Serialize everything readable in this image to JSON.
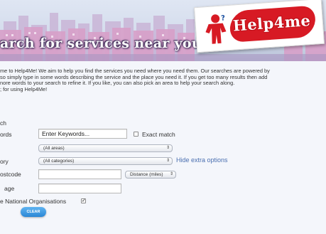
{
  "banner": {
    "title": "arch for services near you...",
    "logo_text": "Help4me"
  },
  "intro": {
    "lines": [
      "me to Help4Me! We aim to help you find the services you need where you need them. Our searches are powered by",
      "so simply type in some words describing the service and the place you need it. If you get too many results then add",
      "nore words to your search to refine it. If you like, you can also pick an area to help your search along.",
      "; for using Help4Me!"
    ]
  },
  "form": {
    "section_label": "ch",
    "keywords_label": "ords",
    "keywords_value": "Enter Keywords...",
    "exact_match_label": "Exact match",
    "area_select": "(All areas)",
    "category_label": "ory",
    "category_select": "(All categories)",
    "hide_options_link": "Hide extra options",
    "postcode_label": "ostcode",
    "postcode_value": "",
    "distance_select": "Distance (miles)",
    "age_label": "age",
    "age_value": "",
    "national_orgs_label": "e National Organisations",
    "national_orgs_checked": "✓",
    "clear_button": "CLEAR"
  }
}
